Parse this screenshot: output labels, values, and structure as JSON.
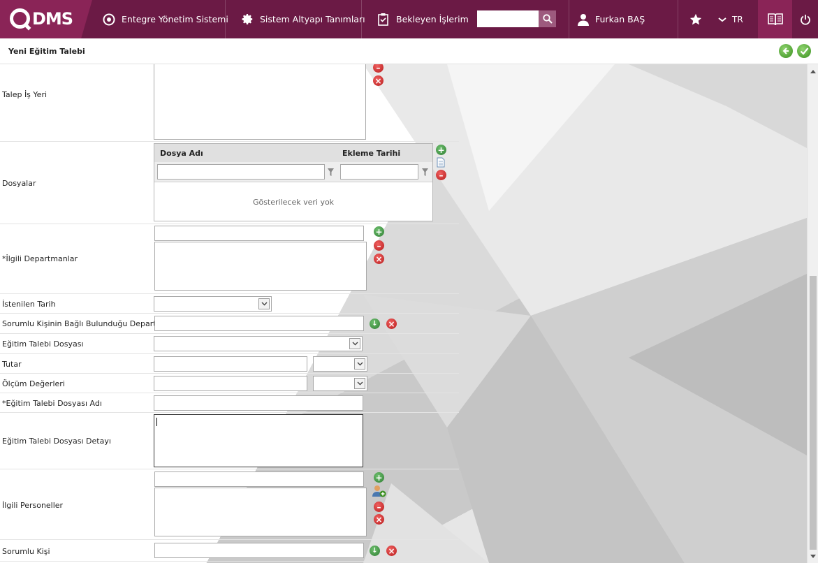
{
  "header": {
    "logo": "DMS",
    "nav": [
      {
        "label": "Entegre Yönetim Sistemi",
        "icon": "target-icon"
      },
      {
        "label": "Sistem Altyapı Tanımları",
        "icon": "gear-icon"
      },
      {
        "label": "Bekleyen İşlerim",
        "icon": "clipboard-icon"
      }
    ],
    "search": {
      "value": "",
      "placeholder": ""
    },
    "user": "Furkan BAŞ",
    "language": "TR"
  },
  "page": {
    "title": "Yeni Eğitim Talebi"
  },
  "form": {
    "talep_is_yeri": {
      "label": "Talep İş Yeri"
    },
    "dosyalar": {
      "label": "Dosyalar",
      "columns": [
        "Dosya Adı",
        "Ekleme Tarihi"
      ],
      "empty_text": "Gösterilecek veri yok"
    },
    "ilgili_departmanlar": {
      "label": "*İlgili Departmanlar"
    },
    "istenilen_tarih": {
      "label": "İstenilen Tarih"
    },
    "sorumlu_departman": {
      "label": "Sorumlu Kişinin Bağlı Bulunduğu Departman"
    },
    "egitim_talebi_dosyasi": {
      "label": "Eğitim Talebi Dosyası"
    },
    "tutar": {
      "label": "Tutar"
    },
    "olcum_degerleri": {
      "label": "Ölçüm Değerleri"
    },
    "egitim_talebi_dosyasi_adi": {
      "label": "*Eğitim Talebi Dosyası Adı"
    },
    "egitim_talebi_dosyasi_detayi": {
      "label": "Eğitim Talebi Dosyası Detayı"
    },
    "ilgili_personeller": {
      "label": "İlgili Personeller"
    },
    "sorumlu_kisi": {
      "label": "Sorumlu Kişi"
    }
  },
  "colors": {
    "topbar": "#6b1a45",
    "logo_bg": "#8a2457",
    "search_button": "#9d5a7e",
    "add_green": "#2e7d32",
    "remove_red": "#b71c1c"
  }
}
